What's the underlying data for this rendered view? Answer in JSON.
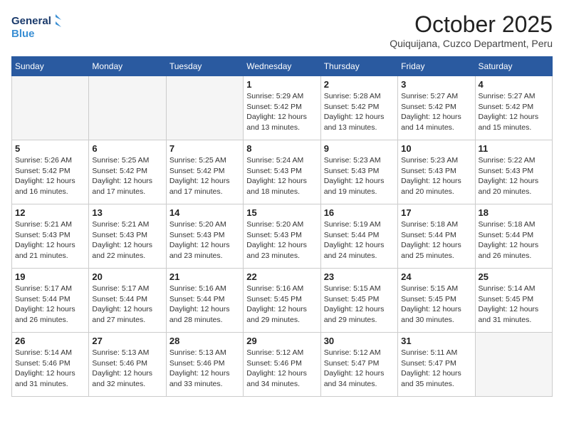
{
  "header": {
    "logo_line1": "General",
    "logo_line2": "Blue",
    "month": "October 2025",
    "location": "Quiquijana, Cuzco Department, Peru"
  },
  "weekdays": [
    "Sunday",
    "Monday",
    "Tuesday",
    "Wednesday",
    "Thursday",
    "Friday",
    "Saturday"
  ],
  "weeks": [
    [
      {
        "day": "",
        "info": ""
      },
      {
        "day": "",
        "info": ""
      },
      {
        "day": "",
        "info": ""
      },
      {
        "day": "1",
        "info": "Sunrise: 5:29 AM\nSunset: 5:42 PM\nDaylight: 12 hours\nand 13 minutes."
      },
      {
        "day": "2",
        "info": "Sunrise: 5:28 AM\nSunset: 5:42 PM\nDaylight: 12 hours\nand 13 minutes."
      },
      {
        "day": "3",
        "info": "Sunrise: 5:27 AM\nSunset: 5:42 PM\nDaylight: 12 hours\nand 14 minutes."
      },
      {
        "day": "4",
        "info": "Sunrise: 5:27 AM\nSunset: 5:42 PM\nDaylight: 12 hours\nand 15 minutes."
      }
    ],
    [
      {
        "day": "5",
        "info": "Sunrise: 5:26 AM\nSunset: 5:42 PM\nDaylight: 12 hours\nand 16 minutes."
      },
      {
        "day": "6",
        "info": "Sunrise: 5:25 AM\nSunset: 5:42 PM\nDaylight: 12 hours\nand 17 minutes."
      },
      {
        "day": "7",
        "info": "Sunrise: 5:25 AM\nSunset: 5:42 PM\nDaylight: 12 hours\nand 17 minutes."
      },
      {
        "day": "8",
        "info": "Sunrise: 5:24 AM\nSunset: 5:43 PM\nDaylight: 12 hours\nand 18 minutes."
      },
      {
        "day": "9",
        "info": "Sunrise: 5:23 AM\nSunset: 5:43 PM\nDaylight: 12 hours\nand 19 minutes."
      },
      {
        "day": "10",
        "info": "Sunrise: 5:23 AM\nSunset: 5:43 PM\nDaylight: 12 hours\nand 20 minutes."
      },
      {
        "day": "11",
        "info": "Sunrise: 5:22 AM\nSunset: 5:43 PM\nDaylight: 12 hours\nand 20 minutes."
      }
    ],
    [
      {
        "day": "12",
        "info": "Sunrise: 5:21 AM\nSunset: 5:43 PM\nDaylight: 12 hours\nand 21 minutes."
      },
      {
        "day": "13",
        "info": "Sunrise: 5:21 AM\nSunset: 5:43 PM\nDaylight: 12 hours\nand 22 minutes."
      },
      {
        "day": "14",
        "info": "Sunrise: 5:20 AM\nSunset: 5:43 PM\nDaylight: 12 hours\nand 23 minutes."
      },
      {
        "day": "15",
        "info": "Sunrise: 5:20 AM\nSunset: 5:43 PM\nDaylight: 12 hours\nand 23 minutes."
      },
      {
        "day": "16",
        "info": "Sunrise: 5:19 AM\nSunset: 5:44 PM\nDaylight: 12 hours\nand 24 minutes."
      },
      {
        "day": "17",
        "info": "Sunrise: 5:18 AM\nSunset: 5:44 PM\nDaylight: 12 hours\nand 25 minutes."
      },
      {
        "day": "18",
        "info": "Sunrise: 5:18 AM\nSunset: 5:44 PM\nDaylight: 12 hours\nand 26 minutes."
      }
    ],
    [
      {
        "day": "19",
        "info": "Sunrise: 5:17 AM\nSunset: 5:44 PM\nDaylight: 12 hours\nand 26 minutes."
      },
      {
        "day": "20",
        "info": "Sunrise: 5:17 AM\nSunset: 5:44 PM\nDaylight: 12 hours\nand 27 minutes."
      },
      {
        "day": "21",
        "info": "Sunrise: 5:16 AM\nSunset: 5:44 PM\nDaylight: 12 hours\nand 28 minutes."
      },
      {
        "day": "22",
        "info": "Sunrise: 5:16 AM\nSunset: 5:45 PM\nDaylight: 12 hours\nand 29 minutes."
      },
      {
        "day": "23",
        "info": "Sunrise: 5:15 AM\nSunset: 5:45 PM\nDaylight: 12 hours\nand 29 minutes."
      },
      {
        "day": "24",
        "info": "Sunrise: 5:15 AM\nSunset: 5:45 PM\nDaylight: 12 hours\nand 30 minutes."
      },
      {
        "day": "25",
        "info": "Sunrise: 5:14 AM\nSunset: 5:45 PM\nDaylight: 12 hours\nand 31 minutes."
      }
    ],
    [
      {
        "day": "26",
        "info": "Sunrise: 5:14 AM\nSunset: 5:46 PM\nDaylight: 12 hours\nand 31 minutes."
      },
      {
        "day": "27",
        "info": "Sunrise: 5:13 AM\nSunset: 5:46 PM\nDaylight: 12 hours\nand 32 minutes."
      },
      {
        "day": "28",
        "info": "Sunrise: 5:13 AM\nSunset: 5:46 PM\nDaylight: 12 hours\nand 33 minutes."
      },
      {
        "day": "29",
        "info": "Sunrise: 5:12 AM\nSunset: 5:46 PM\nDaylight: 12 hours\nand 34 minutes."
      },
      {
        "day": "30",
        "info": "Sunrise: 5:12 AM\nSunset: 5:47 PM\nDaylight: 12 hours\nand 34 minutes."
      },
      {
        "day": "31",
        "info": "Sunrise: 5:11 AM\nSunset: 5:47 PM\nDaylight: 12 hours\nand 35 minutes."
      },
      {
        "day": "",
        "info": ""
      }
    ]
  ]
}
